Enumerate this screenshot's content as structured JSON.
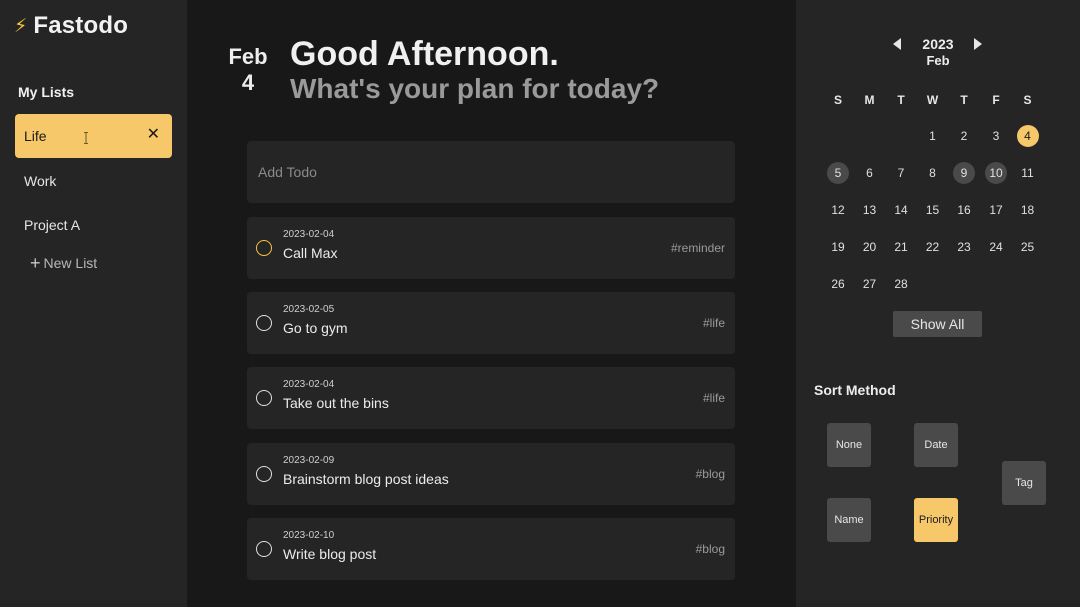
{
  "app": {
    "name": "Fastodo",
    "logo_icon": "lightning-bolt-icon"
  },
  "sidebar": {
    "lists_title": "My Lists",
    "lists": [
      {
        "label": "Life",
        "active": true
      },
      {
        "label": "Work",
        "active": false
      },
      {
        "label": "Project A",
        "active": false
      }
    ],
    "new_list_label": "New List"
  },
  "header": {
    "month": "Feb",
    "day": "4",
    "greeting": "Good Afternoon.",
    "subgreeting": "What's your plan for today?"
  },
  "add_todo": {
    "placeholder": "Add Todo",
    "value": ""
  },
  "todos": [
    {
      "date": "2023-02-04",
      "text": "Call Max",
      "tag": "#reminder",
      "highlight": true
    },
    {
      "date": "2023-02-05",
      "text": "Go to gym",
      "tag": "#life",
      "highlight": false
    },
    {
      "date": "2023-02-04",
      "text": "Take out the bins",
      "tag": "#life",
      "highlight": false
    },
    {
      "date": "2023-02-09",
      "text": "Brainstorm blog post ideas",
      "tag": "#blog",
      "highlight": false
    },
    {
      "date": "2023-02-10",
      "text": "Write blog post",
      "tag": "#blog",
      "highlight": false
    }
  ],
  "calendar": {
    "year": "2023",
    "month": "Feb",
    "weekdays": [
      "S",
      "M",
      "T",
      "W",
      "T",
      "F",
      "S"
    ],
    "days": [
      "1",
      "2",
      "3",
      "4",
      "5",
      "6",
      "7",
      "8",
      "9",
      "10",
      "11",
      "12",
      "13",
      "14",
      "15",
      "16",
      "17",
      "18",
      "19",
      "20",
      "21",
      "22",
      "23",
      "24",
      "25",
      "26",
      "27",
      "28"
    ],
    "today": "4",
    "marked": [
      "5",
      "9",
      "10"
    ],
    "show_all_label": "Show All"
  },
  "sort": {
    "title": "Sort Method",
    "options": [
      "None",
      "Date",
      "Tag",
      "Name",
      "Priority"
    ],
    "selected": "Priority"
  },
  "colors": {
    "accent": "#f7c86a",
    "panel": "#252525",
    "background": "#181818"
  }
}
